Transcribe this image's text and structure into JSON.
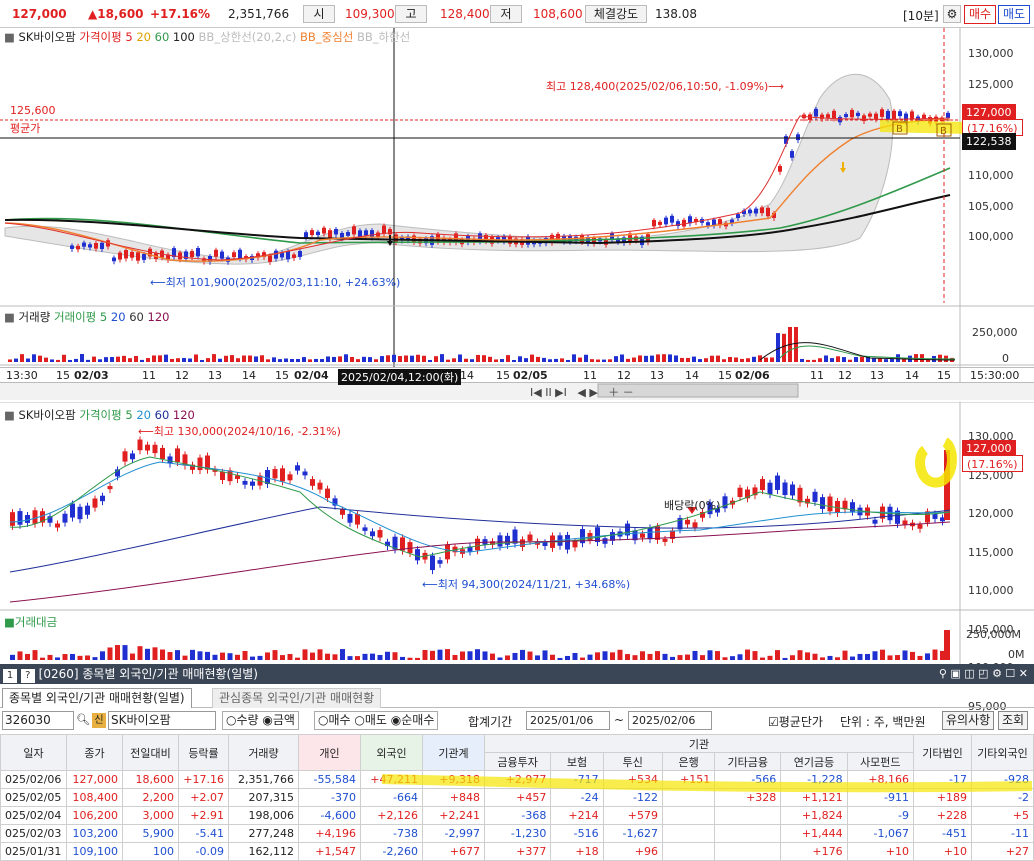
{
  "topbar": {
    "price": "127,000",
    "change": "▲18,600",
    "rate": "+17.16%",
    "volume": "2,351,766",
    "open_label": "시",
    "open": "109,300",
    "high_label": "고",
    "high": "128,400",
    "low_label": "저",
    "low": "108,600",
    "strength_label": "체결강도",
    "strength": "138.08",
    "interval": "[10분]",
    "buy": "매수",
    "sell": "매도"
  },
  "intraday": {
    "header": {
      "name": "SK바이오팜",
      "ma_label": "가격이평",
      "ma": [
        "5",
        "20",
        "60",
        "100"
      ],
      "bb": [
        "BB_상한선(20,2,c)",
        "BB_중심선",
        "BB_하한선"
      ]
    },
    "y_ticks": [
      "130,000",
      "125,000",
      "120,000",
      "115,000",
      "110,000",
      "105,000",
      "100,000"
    ],
    "avg_price": "125,600",
    "avg_label": "평균가",
    "price_tag": "127,000",
    "rate_tag": "(17.16%)",
    "cross_tag": "122,538",
    "high_note": "최고 128,400(2025/02/06,10:50, -1.09%)⟶",
    "low_note": "⟵최저 101,900(2025/02/03,11:10, +24.63%)",
    "vol_header": {
      "label": "거래량",
      "ma_label": "거래이평",
      "ma": [
        "5",
        "20",
        "60",
        "120"
      ]
    },
    "vol_ticks": [
      "250,000",
      "0"
    ],
    "time_axis": [
      "13:30",
      "15",
      "02/03",
      "11",
      "12",
      "13",
      "14",
      "15",
      "02/04",
      "2025/02/04,12:00(화)",
      "14",
      "15",
      "02/05",
      "11",
      "12",
      "13",
      "14",
      "15",
      "02/06",
      "11",
      "12",
      "13",
      "14",
      "15",
      "15:30:00"
    ]
  },
  "daily": {
    "header": {
      "name": "SK바이오팜",
      "ma_label": "가격이평",
      "ma": [
        "5",
        "20",
        "60",
        "120"
      ]
    },
    "y_ticks": [
      "130,000",
      "125,000",
      "120,000",
      "115,000",
      "110,000",
      "105,000",
      "100,000",
      "95,000",
      "90,000"
    ],
    "price_tag": "127,000",
    "rate_tag": "(17.16%)",
    "high_note": "⟵최고 130,000(2024/10/16, -2.31%)",
    "low_note": "⟵최저 94,300(2024/11/21, +34.68%)",
    "dividend": "배당락(0%)",
    "amt_label": "거래대금",
    "amt_ticks": [
      "250,000M",
      "0M"
    ]
  },
  "panel": {
    "num": "1",
    "q": "?",
    "title": "[0260] 종목별 외국인/기관 매매현황(일별)",
    "tabs": [
      "종목별 외국인/기관 매매현황(일별)",
      "관심종목 외국인/기관 매매현황"
    ],
    "code": "326030",
    "flag": "신",
    "name": "SK바이오팜",
    "radio1": [
      "수량",
      "금액"
    ],
    "radio2": [
      "매수",
      "매도",
      "순매수"
    ],
    "period_label": "합계기간",
    "from": "2025/01/06",
    "tilde": "~",
    "to": "2025/02/06",
    "avg_check": "평균단가",
    "unit": "단위 : 주, 백만원",
    "btn1": "유의사항",
    "btn2": "조회"
  },
  "table": {
    "headers": [
      "일자",
      "종가",
      "전일대비",
      "등락률",
      "거래량",
      "개인",
      "외국인",
      "기관계",
      "기관",
      "기타법인",
      "기타외국인"
    ],
    "sub": [
      "금융투자",
      "보험",
      "투신",
      "은행",
      "기타금융",
      "연기금등",
      "사모펀드"
    ],
    "rows": [
      [
        "025/02/06",
        "127,000",
        "18,600",
        "+17.16",
        "2,351,766",
        "-55,584",
        "+47,211",
        "+9,318",
        "+2,977",
        "-717",
        "+534",
        "+151",
        "-566",
        "-1,228",
        "+8,166",
        "-17",
        "-928"
      ],
      [
        "025/02/05",
        "108,400",
        "2,200",
        "+2.07",
        "207,315",
        "-370",
        "-664",
        "+848",
        "+457",
        "-24",
        "-122",
        "",
        "+328",
        "+1,121",
        "-911",
        "+189",
        "-2"
      ],
      [
        "025/02/04",
        "106,200",
        "3,000",
        "+2.91",
        "198,006",
        "-4,600",
        "+2,126",
        "+2,241",
        "-368",
        "+214",
        "+579",
        "",
        "",
        "+1,824",
        "-9",
        "+228",
        "+5"
      ],
      [
        "025/02/03",
        "103,200",
        "5,900",
        "-5.41",
        "277,248",
        "+4,196",
        "-738",
        "-2,997",
        "-1,230",
        "-516",
        "-1,627",
        "",
        "",
        "+1,444",
        "-1,067",
        "-451",
        "-11"
      ],
      [
        "025/01/31",
        "109,100",
        "100",
        "-0.09",
        "162,112",
        "+1,547",
        "-2,260",
        "+677",
        "+377",
        "+18",
        "+96",
        "",
        "",
        "+176",
        "+10",
        "+10",
        "+27"
      ]
    ]
  },
  "chart_data": [
    {
      "type": "candlestick",
      "title": "SK바이오팜 10분",
      "ylim": [
        97000,
        133000
      ],
      "y_ticks": [
        130000,
        125000,
        120000,
        115000,
        110000,
        105000,
        100000
      ],
      "high": 128400,
      "low": 101900,
      "last": 127000,
      "avg": 125600
    },
    {
      "type": "candlestick",
      "title": "SK바이오팜 일봉",
      "ylim": [
        88000,
        132000
      ],
      "y_ticks": [
        130000,
        125000,
        120000,
        115000,
        110000,
        105000,
        100000,
        95000,
        90000
      ],
      "high": 130000,
      "low": 94300,
      "last": 127000
    },
    {
      "type": "bar",
      "title": "거래량",
      "y_ticks": [
        250000,
        0
      ]
    },
    {
      "type": "bar",
      "title": "거래대금",
      "y_ticks": [
        250000,
        0
      ]
    }
  ]
}
